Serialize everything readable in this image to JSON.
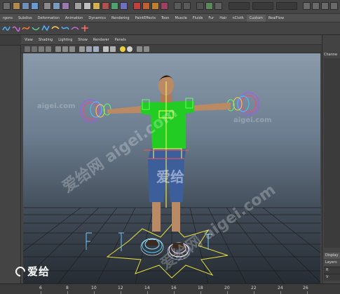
{
  "shelf_tabs": [
    "rgons",
    "Subdivs",
    "Deformation",
    "Animation",
    "Dynamics",
    "Rendering",
    "PaintEffects",
    "Toon",
    "Muscle",
    "Fluids",
    "Fur",
    "Hair",
    "nCloth",
    "Custom",
    "RealFlow"
  ],
  "active_shelf_tab": "Custom",
  "panel_menu": [
    "View",
    "Shading",
    "Lighting",
    "Show",
    "Renderer",
    "Panels"
  ],
  "right_panel": {
    "channels_label": "Channe",
    "display_tab": "Display",
    "layers_tab": "Layers",
    "layer_rows": [
      "R",
      "R",
      "V",
      "V",
      "V",
      "V"
    ]
  },
  "timeline": {
    "labels": [
      "6",
      "8",
      "10",
      "12",
      "14",
      "16",
      "18",
      "20",
      "22",
      "24",
      "26"
    ]
  },
  "brand": {
    "text": "爱给"
  },
  "watermarks": {
    "center": "爱给",
    "diagonal": "爱给网 aigei.com",
    "small": "aigei.com"
  },
  "colors": {
    "viewport_top": "#8a9aaa",
    "viewport_bottom": "#262c33",
    "panel_bg": "#444444",
    "shirt": "#22cc22",
    "jeans": "#3c5f9c"
  }
}
